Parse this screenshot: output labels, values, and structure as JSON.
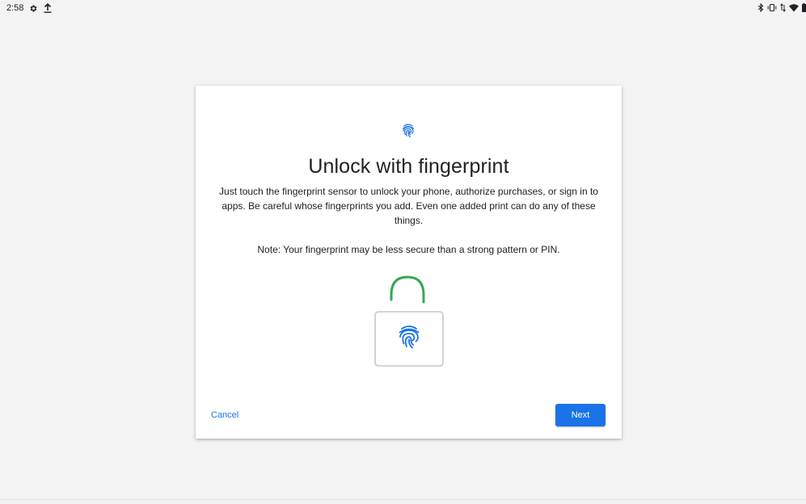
{
  "status_bar": {
    "time": "2:58",
    "left_icons": [
      "settings-icon",
      "upload-icon"
    ],
    "right_icons": [
      "bluetooth-icon",
      "vibrate-icon",
      "data-arrows-icon",
      "wifi-icon",
      "battery-icon"
    ]
  },
  "dialog": {
    "header_icon": "fingerprint-icon",
    "title": "Unlock with fingerprint",
    "description": "Just touch the fingerprint sensor to unlock your phone, authorize purchases, or sign in to apps. Be careful whose fingerprints you add. Even one added print can do any of these things.",
    "note": "Note: Your fingerprint may be less secure than a strong pattern or PIN.",
    "illustration": "unlocked-padlock-fingerprint-illustration",
    "cancel_label": "Cancel",
    "next_label": "Next"
  },
  "colors": {
    "accent": "#1a73e8",
    "lock_shackle": "#34a853",
    "background": "#f3f3f3",
    "card": "#ffffff"
  }
}
